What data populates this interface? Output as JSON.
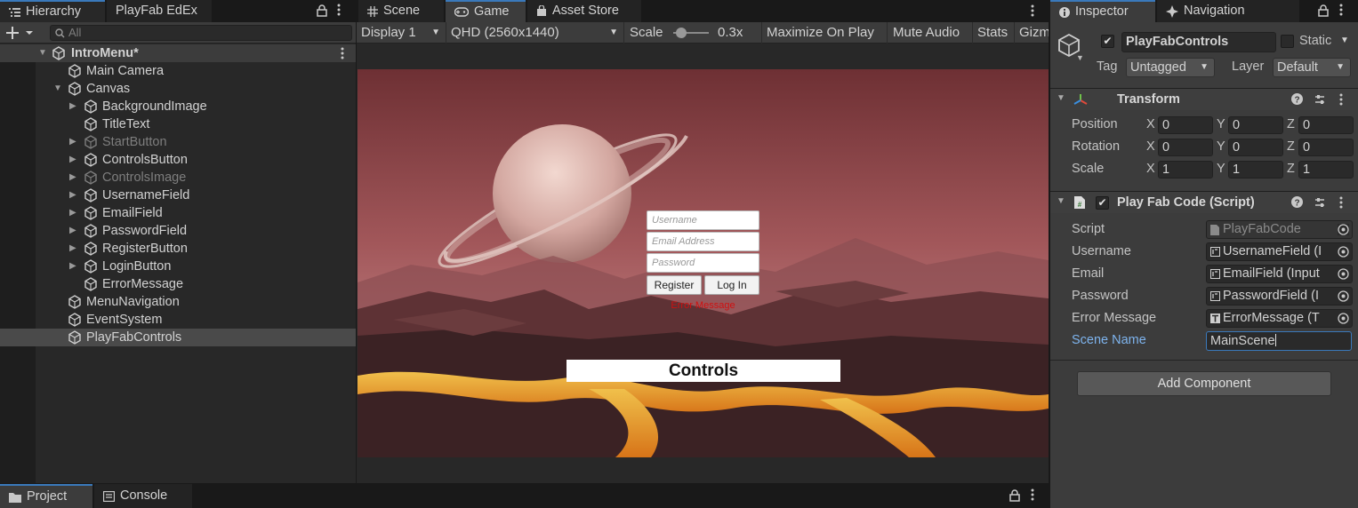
{
  "hierarchy": {
    "tab_label": "Hierarchy",
    "tab2_label": "PlayFab EdEx",
    "search_placeholder": "All",
    "scene": "IntroMenu*",
    "items": [
      {
        "label": "Main Camera"
      },
      {
        "label": "Canvas"
      },
      {
        "label": "BackgroundImage"
      },
      {
        "label": "TitleText"
      },
      {
        "label": "StartButton"
      },
      {
        "label": "ControlsButton"
      },
      {
        "label": "ControlsImage"
      },
      {
        "label": "UsernameField"
      },
      {
        "label": "EmailField"
      },
      {
        "label": "PasswordField"
      },
      {
        "label": "RegisterButton"
      },
      {
        "label": "LoginButton"
      },
      {
        "label": "ErrorMessage"
      },
      {
        "label": "MenuNavigation"
      },
      {
        "label": "EventSystem"
      },
      {
        "label": "PlayFabControls"
      }
    ]
  },
  "game": {
    "tabs": [
      {
        "label": "Scene"
      },
      {
        "label": "Game"
      },
      {
        "label": "Asset Store"
      }
    ],
    "display": "Display 1",
    "resolution": "QHD (2560x1440)",
    "scale_label": "Scale",
    "scale_value": "0.3x",
    "maximize": "Maximize On Play",
    "mute": "Mute Audio",
    "stats": "Stats",
    "gizmos": "Gizmos",
    "ui": {
      "username_placeholder": "Username",
      "email_placeholder": "Email Address",
      "password_placeholder": "Password",
      "register": "Register",
      "login": "Log In",
      "error": "Error Message",
      "controls": "Controls"
    }
  },
  "inspector": {
    "tab_label": "Inspector",
    "tab2_label": "Navigation",
    "object_name": "PlayFabControls",
    "static_label": "Static",
    "tag_label": "Tag",
    "tag_value": "Untagged",
    "layer_label": "Layer",
    "layer_value": "Default",
    "transform": {
      "title": "Transform",
      "rows": [
        {
          "label": "Position",
          "x": "0",
          "y": "0",
          "z": "0"
        },
        {
          "label": "Rotation",
          "x": "0",
          "y": "0",
          "z": "0"
        },
        {
          "label": "Scale",
          "x": "1",
          "y": "1",
          "z": "1"
        }
      ]
    },
    "script_component": {
      "title": "Play Fab Code (Script)",
      "fields": [
        {
          "label": "Script",
          "value": "PlayFabCode"
        },
        {
          "label": "Username",
          "value": "UsernameField (I"
        },
        {
          "label": "Email",
          "value": "EmailField (Input"
        },
        {
          "label": "Password",
          "value": "PasswordField (I"
        },
        {
          "label": "Error Message",
          "value": "ErrorMessage (T"
        }
      ],
      "scene_name_label": "Scene Name",
      "scene_name_value": "MainScene"
    },
    "add_component": "Add Component"
  },
  "bottom": {
    "tabs": [
      {
        "label": "Project"
      },
      {
        "label": "Console"
      }
    ]
  },
  "colors": {
    "accent": "#3a79bb",
    "error_text": "#d01010",
    "link_label": "#7eb4ee"
  }
}
